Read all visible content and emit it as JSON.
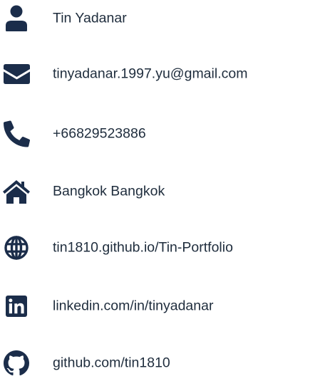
{
  "contact": {
    "name": {
      "icon": "user-icon",
      "text": "Tin Yadanar"
    },
    "email": {
      "icon": "envelope-icon",
      "text": "tinyadanar.1997.yu@gmail.com"
    },
    "phone": {
      "icon": "phone-icon",
      "text": "+66829523886"
    },
    "location": {
      "icon": "home-icon",
      "text": "Bangkok Bangkok"
    },
    "website": {
      "icon": "globe-icon",
      "text": "tin1810.github.io/Tin-Portfolio"
    },
    "linkedin": {
      "icon": "linkedin-icon",
      "text": "linkedin.com/in/tinyadanar"
    },
    "github": {
      "icon": "github-icon",
      "text": "github.com/tin1810"
    }
  },
  "colors": {
    "icon": "#1b2d4a",
    "text": "#1f2d3d",
    "background": "#ffffff"
  }
}
